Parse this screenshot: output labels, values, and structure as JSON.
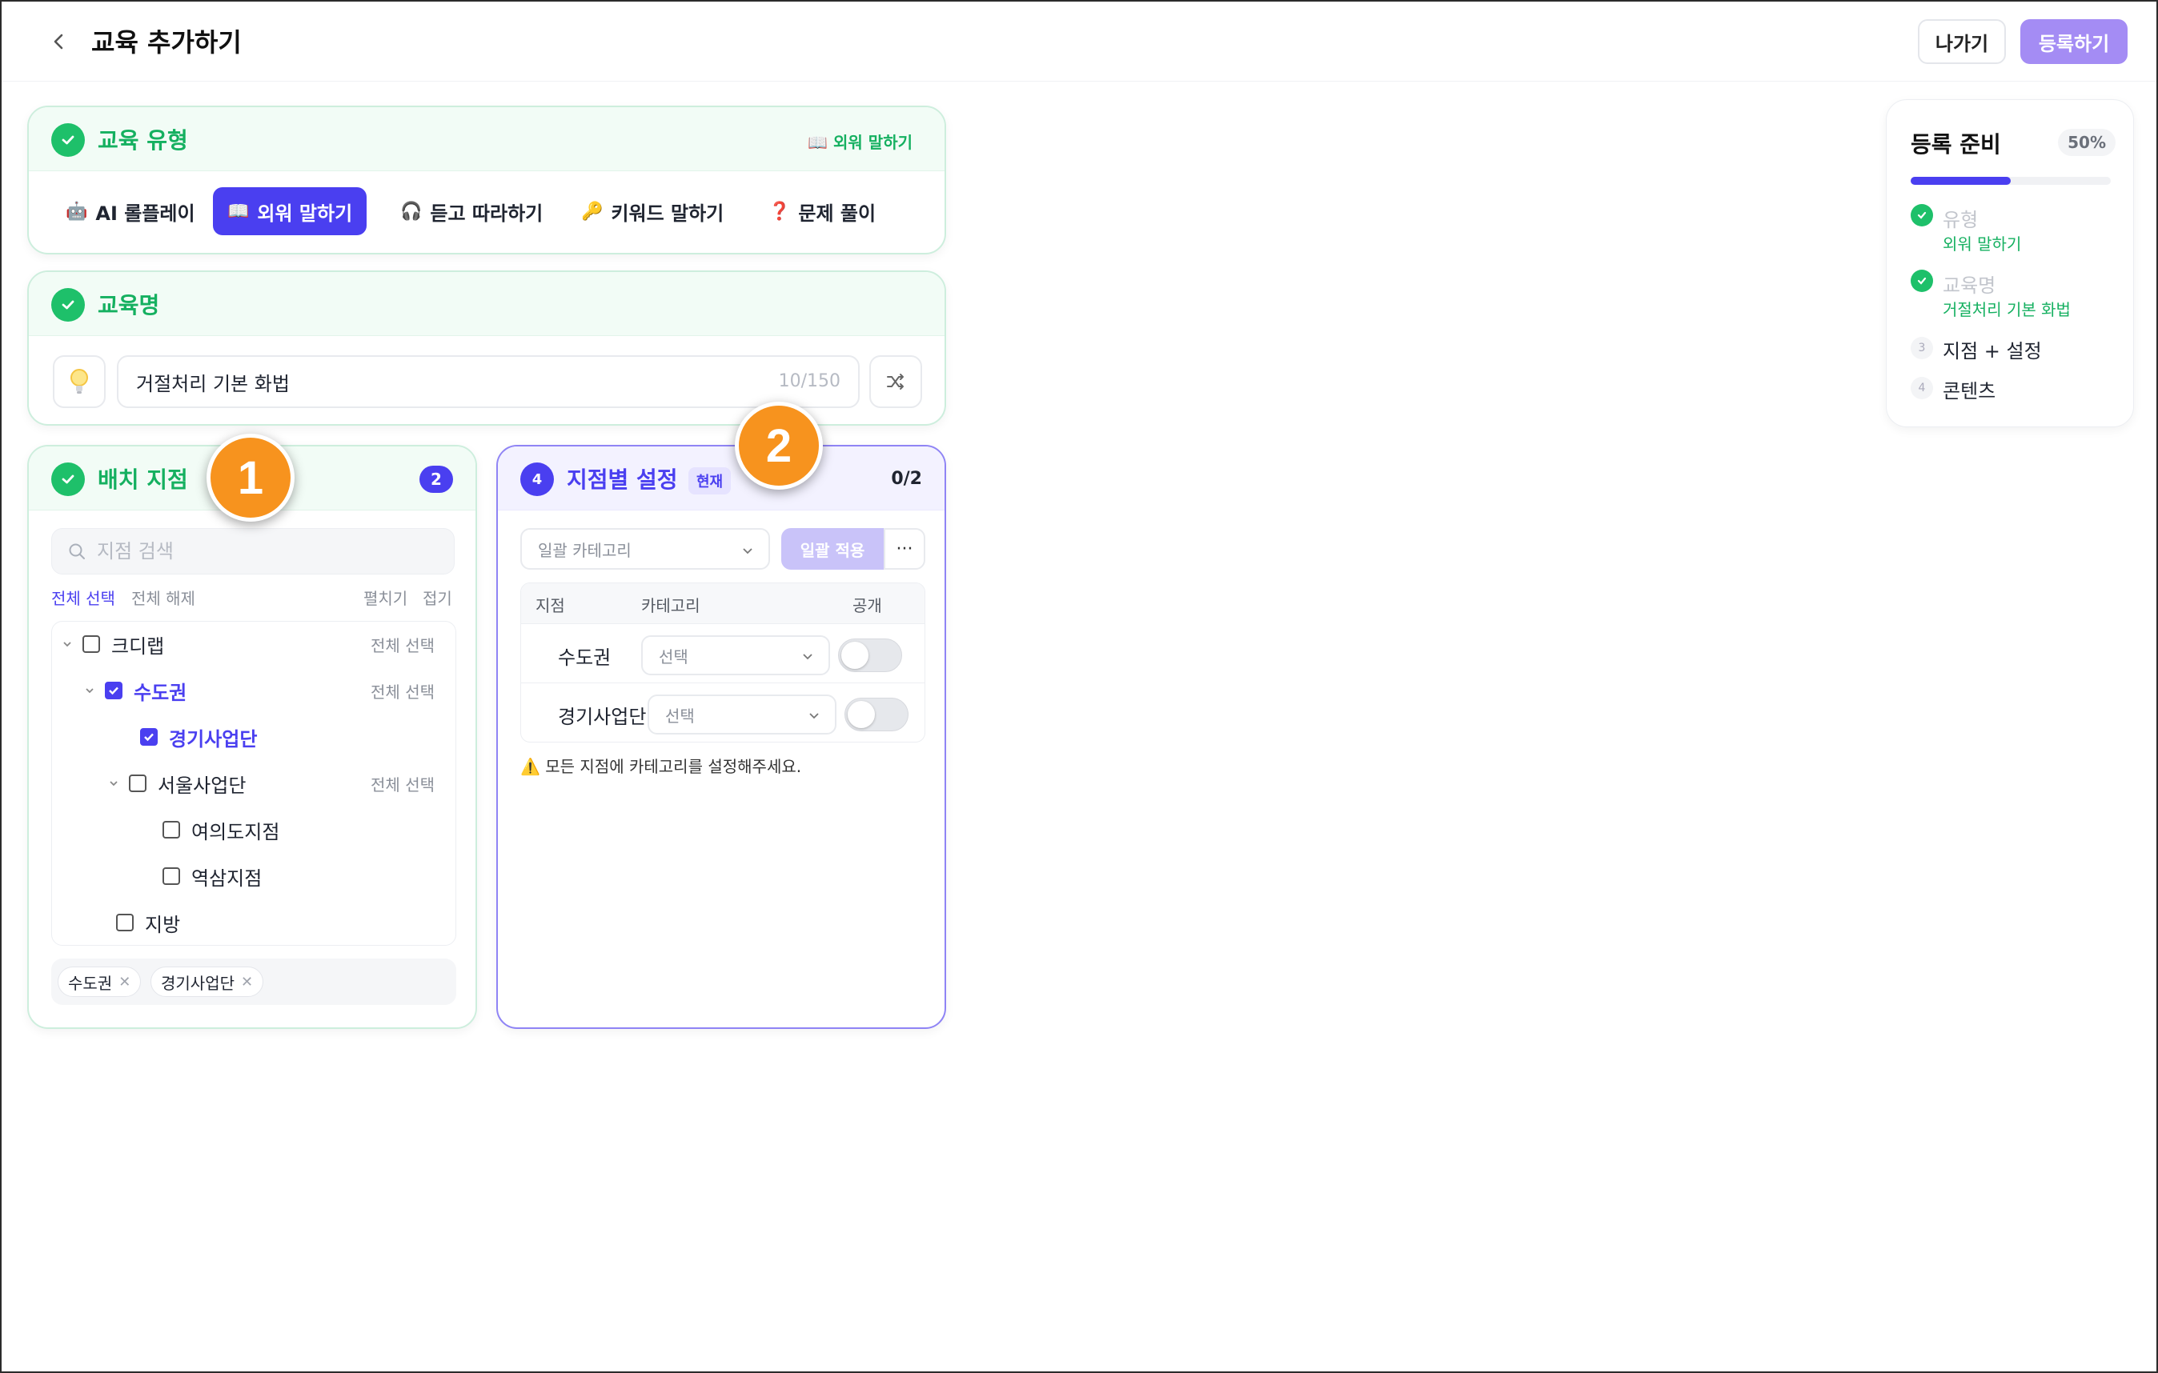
{
  "header": {
    "title": "교육 추가하기",
    "exit_label": "나가기",
    "submit_label": "등록하기"
  },
  "type_card": {
    "title": "교육 유형",
    "selected_badge": "📖 외워 말하기",
    "tabs": [
      {
        "icon": "🤖",
        "label": "AI 롤플레이",
        "active": false
      },
      {
        "icon": "📖",
        "label": "외워 말하기",
        "active": true
      },
      {
        "icon": "🎧",
        "label": "듣고 따라하기",
        "active": false
      },
      {
        "icon": "🔑",
        "label": "키워드 말하기",
        "active": false
      },
      {
        "icon": "❓",
        "label": "문제 풀이",
        "active": false
      }
    ]
  },
  "name_card": {
    "title": "교육명",
    "value": "거절처리 기본 화법",
    "count": "10/150"
  },
  "branch_card": {
    "title": "배치 지점",
    "count": "2",
    "search_placeholder": "지점 검색",
    "select_all": "전체 선택",
    "deselect_all": "전체 해제",
    "expand": "펼치기",
    "collapse": "접기",
    "tree": [
      {
        "label": "크디랩",
        "checked": false,
        "all_select": "전체 선택"
      },
      {
        "label": "수도권",
        "checked": true,
        "all_select": "전체 선택"
      },
      {
        "label": "경기사업단",
        "checked": true
      },
      {
        "label": "서울사업단",
        "checked": false,
        "all_select": "전체 선택"
      },
      {
        "label": "여의도지점",
        "checked": false
      },
      {
        "label": "역삼지점",
        "checked": false
      },
      {
        "label": "지방",
        "checked": false
      }
    ],
    "chips": [
      "수도권",
      "경기사업단"
    ]
  },
  "settings_card": {
    "step": "4",
    "title": "지점별 설정",
    "current_badge": "현재",
    "progress": "0/2",
    "bulk_category_placeholder": "일괄 카테고리",
    "bulk_apply": "일괄 적용",
    "more": "···",
    "columns": [
      "지점",
      "카테고리",
      "공개"
    ],
    "rows": [
      {
        "name": "수도권",
        "category": "선택",
        "public": false
      },
      {
        "name": "경기사업단",
        "category": "선택",
        "public": false
      }
    ],
    "warning_icon": "⚠️",
    "warning": "모든 지점에 카테고리를 설정해주세요."
  },
  "annotations": [
    "1",
    "2"
  ],
  "sidebar": {
    "title": "등록 준비",
    "percent": "50%",
    "progress_fraction": 0.5,
    "steps": [
      {
        "num": "",
        "label": "유형",
        "sub": "외워 말하기",
        "done": true
      },
      {
        "num": "",
        "label": "교육명",
        "sub": "거절처리 기본 화법",
        "done": true
      },
      {
        "num": "3",
        "label": "지점 + 설정",
        "done": false
      },
      {
        "num": "4",
        "label": "콘텐츠",
        "done": false
      }
    ]
  },
  "colors": {
    "accent": "#4a3ff0",
    "success": "#1ec06a",
    "annotation": "#f7931e"
  }
}
